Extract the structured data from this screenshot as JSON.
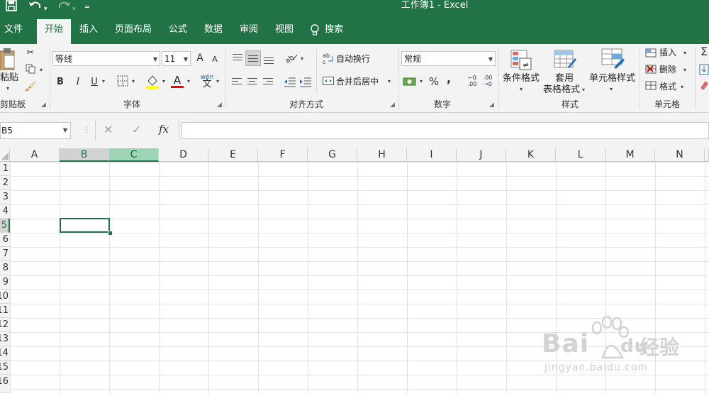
{
  "window": {
    "title": "工作簿1  -  Excel"
  },
  "qat": {
    "save_icon": "save-icon",
    "undo_icon": "undo-icon",
    "redo_icon": "redo-icon",
    "customize_icon": "customize-qat-icon"
  },
  "tabs": [
    {
      "label": "文件"
    },
    {
      "label": "开始"
    },
    {
      "label": "插入"
    },
    {
      "label": "页面布局"
    },
    {
      "label": "公式"
    },
    {
      "label": "数据"
    },
    {
      "label": "审阅"
    },
    {
      "label": "视图"
    }
  ],
  "search": {
    "label": "搜索"
  },
  "clipboard": {
    "paste_label": "粘贴",
    "group_label": "剪贴板"
  },
  "font": {
    "name": "等线",
    "size": "11",
    "bold": "B",
    "italic": "I",
    "underline": "U",
    "font_color_glyph": "A",
    "phonetic": "wén",
    "group_label": "字体",
    "grow": "A",
    "shrink": "A"
  },
  "alignment": {
    "wrap_label": "自动换行",
    "merge_label": "合并后居中",
    "group_label": "对齐方式"
  },
  "number": {
    "format": "常规",
    "percent": "%",
    "comma": ",",
    "group_label": "数字",
    "inc_decimal": ".00",
    "dec_decimal": ".00"
  },
  "styles": {
    "conditional_label": "条件格式",
    "table_label_1": "套用",
    "table_label_2": "表格格式",
    "cell_styles_label": "单元格样式",
    "group_label": "样式"
  },
  "cells": {
    "insert_label": "插入",
    "delete_label": "删除",
    "format_label": "格式",
    "group_label": "单元格"
  },
  "formula_bar": {
    "name_box": "B5",
    "cancel": "✕",
    "enter": "✓",
    "fx": "fx",
    "value": ""
  },
  "sheet": {
    "columns": [
      "A",
      "B",
      "C",
      "D",
      "E",
      "F",
      "G",
      "H",
      "I",
      "J",
      "K",
      "L",
      "M",
      "N"
    ],
    "rows": [
      "1",
      "2",
      "3",
      "4",
      "5",
      "6",
      "7",
      "8",
      "9",
      "10",
      "11",
      "12",
      "13",
      "14",
      "15",
      "16"
    ],
    "active_cell": "B5"
  },
  "colors": {
    "accent": "#217346",
    "highlight_col": "#9fd5b7",
    "fill_yellow": "#ffff00",
    "font_red": "#ff0000"
  },
  "watermark": {
    "brand": "Bai",
    "brand2": "du",
    "cn": "经验",
    "url": "jingyan.baidu.com"
  }
}
